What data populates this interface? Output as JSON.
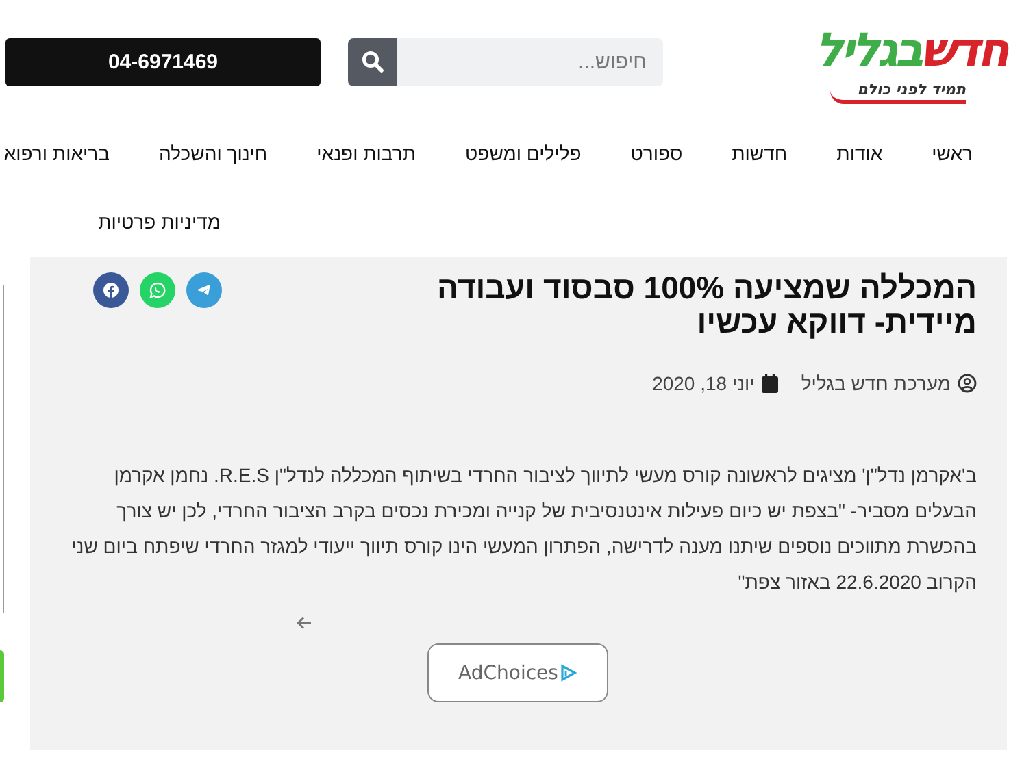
{
  "header": {
    "logo": {
      "part_1": "חדש",
      "part_2": "בגליל",
      "tagline": "תמיד לפני כולם"
    },
    "search": {
      "placeholder": "חיפוש..."
    },
    "phone_button": "04-6971469"
  },
  "nav": {
    "items": [
      "ראשי",
      "אודות",
      "חדשות",
      "ספורט",
      "פלילים ומשפט",
      "תרבות ופנאי",
      "חינוך והשכלה",
      "בריאות ורפוא"
    ],
    "second_row": [
      "מדיניות פרטיות"
    ]
  },
  "article": {
    "title": "המכללה שמציעה 100% סבסוד ועבודה מיידית- דווקא עכשיו",
    "share": [
      {
        "kind": "facebook",
        "color": "#3b5998"
      },
      {
        "kind": "whatsapp",
        "color": "#25d366"
      },
      {
        "kind": "telegram",
        "color": "#3a9fd9"
      }
    ],
    "author": "מערכת חדש בגליל",
    "date": "יוני 18, 2020",
    "body": "ב'אקרמן נדל\"ן' מציגים לראשונה קורס מעשי לתיווך לציבור החרדי בשיתוף המכללה לנדל\"ן R.E.S. נחמן אקרמן הבעלים מסביר- \"בצפת יש כיום פעילות אינטנסיבית של קנייה ומכירת נכסים בקרב הציבור החרדי, לכן יש צורך בהכשרת מתווכים נוספים שיתנו מענה לדרישה, הפתרון המעשי הינו קורס תיווך ייעודי למגזר החרדי שיפתח ביום שני הקרוב 22.6.2020 באזור צפת\"",
    "ad_button": "AdChoices"
  }
}
